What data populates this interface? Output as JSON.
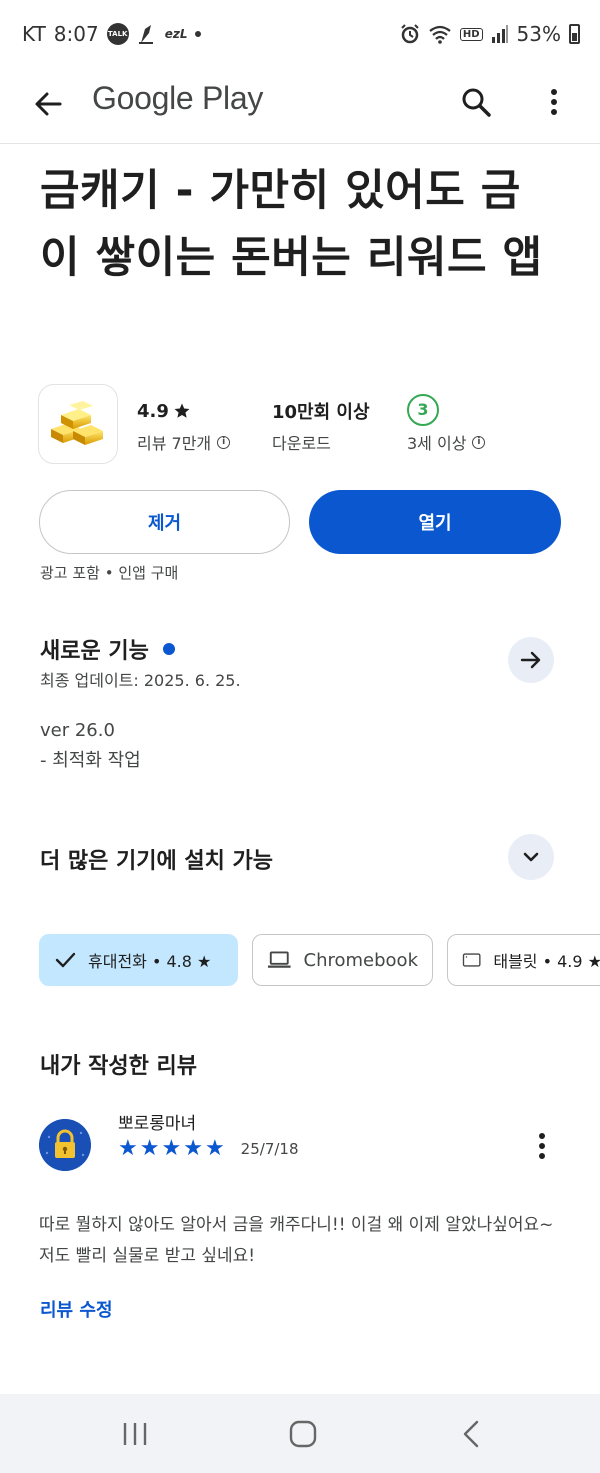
{
  "status_bar": {
    "carrier": "KT",
    "time": "8:07",
    "talk_icon_label": "TALK",
    "ezl_label": "ezL",
    "hd_label": "HD",
    "battery": "53%"
  },
  "app_bar": {
    "title": "Google Play"
  },
  "app": {
    "title": "금캐기 - 가만히 있어도 금이 쌓이는 돈버는 리워드 앱",
    "rating": "4.9",
    "reviews_label": "리뷰 7만개",
    "downloads": "10만회 이상",
    "downloads_label": "다운로드",
    "age_rating": "3",
    "age_label": "3세 이상"
  },
  "actions": {
    "uninstall": "제거",
    "open": "열기",
    "ads_note": "광고 포함 • 인앱 구매"
  },
  "whats_new": {
    "title": "새로운 기능",
    "last_updated": "최종 업데이트: 2025. 6. 25.",
    "version": "ver 26.0",
    "note": "- 최적화 작업"
  },
  "devices": {
    "title": "더 많은 기기에 설치 가능",
    "chips": [
      {
        "label": "휴대전화 • 4.8 ★",
        "selected": true
      },
      {
        "label": "Chromebook",
        "selected": false
      },
      {
        "label": "태블릿 • 4.9 ★",
        "selected": false
      }
    ]
  },
  "my_review": {
    "title": "내가 작성한 리뷰",
    "reviewer": "뽀로롱마녀",
    "stars": 5,
    "date": "25/7/18",
    "text": "따로 뭘하지 않아도 알아서 금을 캐주다니!! 이걸 왜 이제 알았나싶어요~ 저도 빨리 실물로 받고 싶네요!",
    "edit_label": "리뷰 수정"
  },
  "colors": {
    "accent": "#0b57d0",
    "chip_selected": "#c2e7ff",
    "age_green": "#34a853"
  }
}
